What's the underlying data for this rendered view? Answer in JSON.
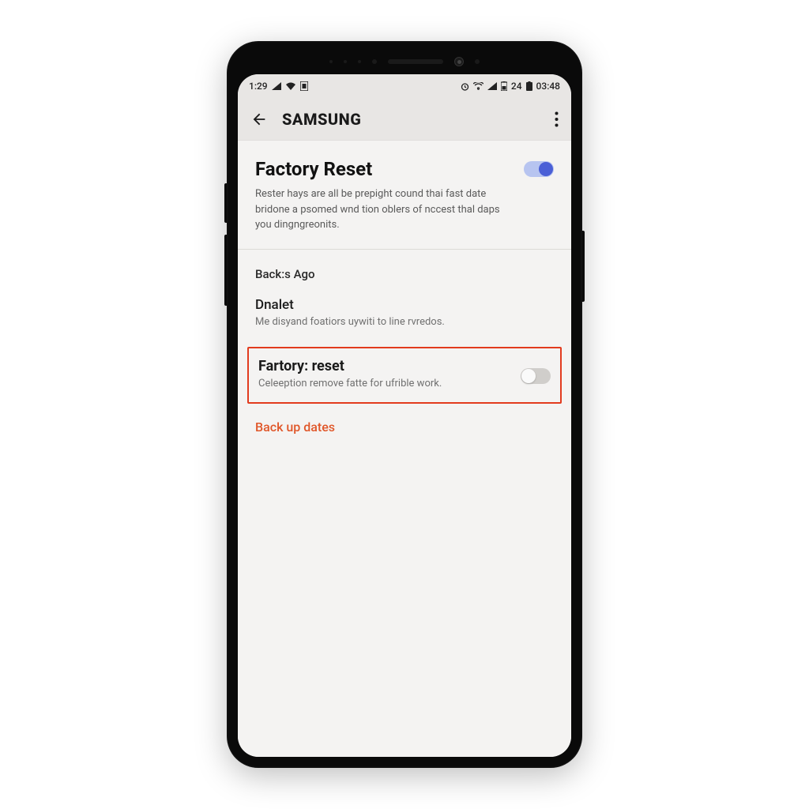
{
  "status_bar": {
    "time_left": "1:29",
    "battery_text": "24",
    "time_right": "03:48"
  },
  "app_bar": {
    "brand": "SAMSUNG"
  },
  "header": {
    "title": "Factory Reset",
    "description": "Rester hays are all be prepight cound thai fast date bridone a psomed wnd tion oblers of nccest thal daps you dingngreonits.",
    "toggle_on": true
  },
  "section_label": "Back:s Ago",
  "items": {
    "dnalet": {
      "title": "Dnalet",
      "sub": "Me disyand foatiors uywiti to line rvredos."
    },
    "factory_reset": {
      "title": "Fartory: reset",
      "sub": "Celeeption remove fatte for ufrible work.",
      "toggle_on": false
    }
  },
  "link": {
    "label": "Back up dates"
  },
  "colors": {
    "highlight": "#e23b1e",
    "accent_link": "#e0572a",
    "toggle_on_knob": "#4a5fd6"
  }
}
